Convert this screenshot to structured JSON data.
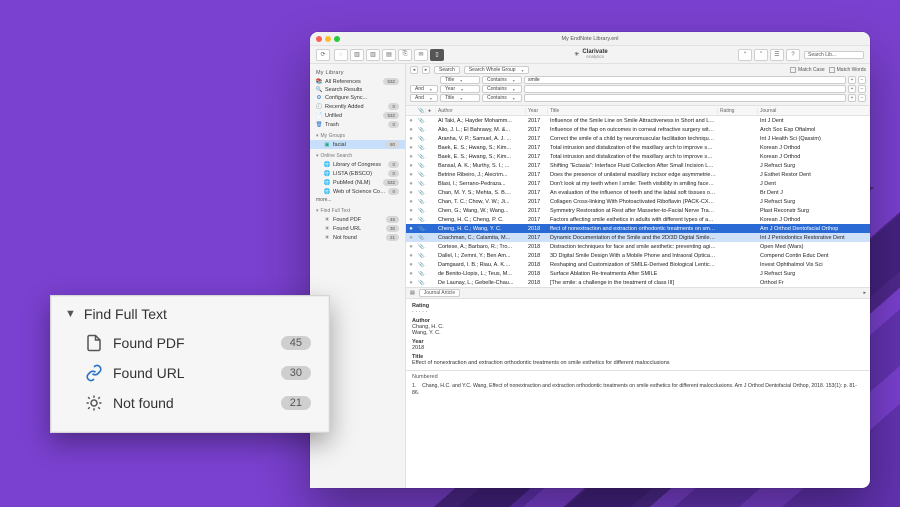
{
  "window": {
    "title": "My EndNote Library.enl",
    "brand": {
      "name": "Clarivate",
      "sub": "Analytics"
    }
  },
  "sidebar": {
    "header": "My Library",
    "top": [
      {
        "icon": "📚",
        "label": "All References",
        "count": "532"
      },
      {
        "icon": "🔍",
        "label": "Search Results",
        "count": ""
      },
      {
        "icon": "⚙",
        "label": "Configure Sync...",
        "count": ""
      },
      {
        "icon": "🕘",
        "label": "Recently Added",
        "count": "0"
      },
      {
        "icon": "📄",
        "label": "Unfiled",
        "count": "532"
      },
      {
        "icon": "🗑",
        "label": "Trash",
        "count": "0"
      }
    ],
    "groupsTitle": "My Groups",
    "groups": [
      {
        "label": "facial",
        "count": "80"
      }
    ],
    "onlineTitle": "Online Search",
    "online": [
      {
        "label": "Library of Congress",
        "count": "0"
      },
      {
        "label": "LISTA (EBSCO)",
        "count": "0"
      },
      {
        "label": "PubMed (NLM)",
        "count": "532"
      },
      {
        "label": "Web of Science Core Collection...",
        "count": "0"
      }
    ],
    "more": "more...",
    "fftTitle": "Find Full Text",
    "fft": [
      {
        "label": "Found PDF",
        "count": "45"
      },
      {
        "label": "Found URL",
        "count": "30"
      },
      {
        "label": "Not found",
        "count": "21"
      }
    ]
  },
  "searchbar": {
    "btnLeft": "◂",
    "btnRight": "▸",
    "searchLbl": "Search",
    "wholeGroup": "Search Whole Group",
    "matchCase": "Match Case",
    "matchWords": "Match Words",
    "rows": [
      {
        "op": "",
        "field": "Title",
        "cond": "Contains",
        "term": "smile"
      },
      {
        "op": "And",
        "field": "Year",
        "cond": "Contains",
        "term": ""
      },
      {
        "op": "And",
        "field": "Title",
        "cond": "Contains",
        "term": ""
      }
    ]
  },
  "columns": {
    "author": "Author",
    "year": "Year",
    "title": "Title",
    "rating": "Rating",
    "journal": "Journal"
  },
  "rows": [
    {
      "a": "Al Taki, A.; Hayder Mohamm...",
      "y": "2017",
      "t": "Influence of the Smile Line on Smile Attractiveness in Short and Long...",
      "j": "Int J Dent"
    },
    {
      "a": "Alio, J. L.; El Bahrawy, M. &...",
      "y": "2017",
      "t": "Influence of the flap on outcomes in corneal refractive surgery with fem...",
      "j": "Arch Soc Esp Oftalmol"
    },
    {
      "a": "Aranha, V. P.; Samuel, A. J. ...",
      "y": "2017",
      "t": "Correct the smile of a child by neuromuscular facilitation technique: A...",
      "j": "Int J Health Sci (Qassim)"
    },
    {
      "a": "Baek, E. S.; Hwang, S.; Kim...",
      "y": "2017",
      "t": "Total intrusion and distalization of the maxillary arch to improve smile...",
      "j": "Korean J Orthod"
    },
    {
      "a": "Baek, E. S.; Hwang, S.; Kim...",
      "y": "2017",
      "t": "Total intrusion and distalization of the maxillary arch to improve smile...",
      "j": "Korean J Orthod"
    },
    {
      "a": "Bansal, A. K.; Murthy, S. I.; ...",
      "y": "2017",
      "t": "Shifting \"Ectasia\": Interface Fluid Collection After Small Incision Lenti...",
      "j": "J Refract Surg"
    },
    {
      "a": "Betrine Ribeiro, J.; Alecrim...",
      "y": "2017",
      "t": "Does the presence of unilateral maxillary incisor edge asymmetries in...",
      "j": "J Esthet Restor Dent"
    },
    {
      "a": "Blasi, I.; Serrano-Pedraza...",
      "y": "2017",
      "t": "Don't look at my teeth when I smile: Teeth visibility in smiling faces aff...",
      "j": "J Dent"
    },
    {
      "a": "Chan, M. Y. S.; Mehta, S. B....",
      "y": "2017",
      "t": "An evaluation of the influence of teeth and the labial soft tissues on th...",
      "j": "Br Dent J"
    },
    {
      "a": "Chan, T. C.; Chow, V. W.; Ji...",
      "y": "2017",
      "t": "Collagen Cross-linking With Photoactivated Riboflavin (PACK-CXL) for...",
      "j": "J Refract Surg"
    },
    {
      "a": "Chen, G.; Wang, W.; Wang...",
      "y": "2017",
      "t": "Symmetry Restoration at Rest after Masseter-to-Facial Nerve Transfer:...",
      "j": "Plast Reconstr Surg"
    },
    {
      "a": "Cheng, H. C.; Cheng, P. C.",
      "y": "2017",
      "t": "Factors affecting smile esthetics in adults with different types of anter...",
      "j": "Korean J Orthod"
    },
    {
      "a": "Cheng, H. C.; Wang, Y. C.",
      "y": "2018",
      "t": "ffect of nonextraction and extraction orthodontic treatments on smile ...",
      "j": "Am J Orthod Dentofacial Orthop",
      "sel": true
    },
    {
      "a": "Coachman, C.; Calamita, M...",
      "y": "2017",
      "t": "Dynamic Documentation of the Smile and the 2D/3D Digital Smile Desi...",
      "j": "Int J Periodontics Restorative Dent",
      "sel2": true
    },
    {
      "a": "Cortese, A.; Barbaro, R.; Tro...",
      "y": "2018",
      "t": "Distraction techniques for face and smile aesthetic: preventing aging i...",
      "j": "Open Med (Wars)"
    },
    {
      "a": "Dallel, I.; Zemni, Y.; Ben Am...",
      "y": "2018",
      "t": "3D Digital Smile Design With a Mobile Phone and Intraoral Optical Sca...",
      "j": "Compend Contin Educ Dent"
    },
    {
      "a": "Damgaard, I. B.; Riau, A. K....",
      "y": "2018",
      "t": "Reshaping and Customization of SMILE-Derived Biological Lenticules...",
      "j": "Invest Ophthalmol Vis Sci"
    },
    {
      "a": "de Benito-Llopis, L.; Teus, M...",
      "y": "2018",
      "t": "Surface Ablation Re-treatments After SMILE",
      "j": "J Refract Surg"
    },
    {
      "a": "De Launay, L.; Gebelle-Chau...",
      "y": "2018",
      "t": "[The smile: a challenge in the treatment of class III]",
      "j": "Orthod Fr"
    }
  ],
  "pane": {
    "type": "Journal Article",
    "ratingL": "Rating",
    "authorL": "Author",
    "authors": "Chang, H. C.\nWang, Y. C.",
    "yearL": "Year",
    "year": "2018",
    "titleL": "Title",
    "title": "Effect of nonextraction and extraction orthodontic treatments on smile esthetics for different malocclusions"
  },
  "citation": {
    "tab": "Numbered",
    "num": "1.",
    "text": "Chang, H.C. and Y.C. Wang, Effect of nonextraction and extraction orthodontic treatments on smile esthetics for different malocclusions. Am J Orthod Dentofacial Orthop, 2018. 153(1): p. 81-86."
  },
  "callout": {
    "title": "Find Full Text",
    "rows": [
      {
        "ico": "pdf",
        "label": "Found PDF",
        "count": "45"
      },
      {
        "ico": "url",
        "label": "Found URL",
        "count": "30"
      },
      {
        "ico": "not",
        "label": "Not found",
        "count": "21"
      }
    ]
  }
}
